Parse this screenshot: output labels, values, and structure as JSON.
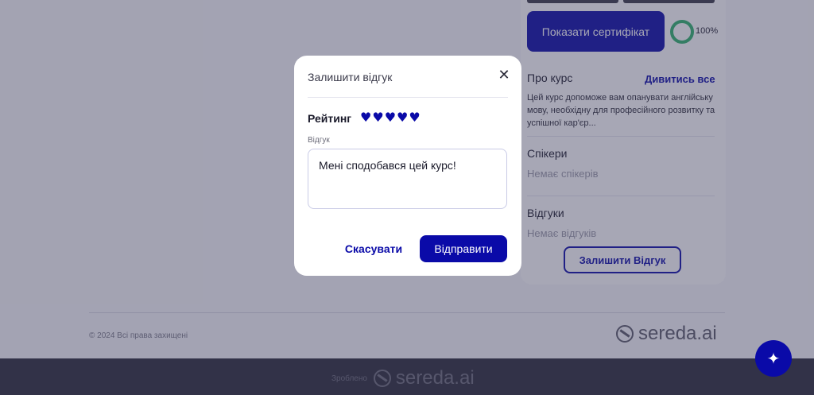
{
  "course_panel": {
    "certificate_button": "Показати сертифікат",
    "progress_percent": "100%",
    "progress_value": 100,
    "about_title": "Про курс",
    "see_all_link": "Дивитись все",
    "about_text": "Цей курс допоможе вам опанувати англійську мову, необхідну для професійного розвитку та успішної кар'єр...",
    "speakers_title": "Спікери",
    "speakers_empty": "Немає спікерів",
    "reviews_title": "Відгуки",
    "reviews_empty": "Немає відгуків",
    "leave_review_button": "Залишити Відгук"
  },
  "footer": {
    "copyright": "© 2024 Всі права захищені",
    "brand": "sereda.ai",
    "made_by_label": "Зроблено",
    "made_by_brand": "sereda.ai"
  },
  "modal": {
    "title": "Залишити відгук",
    "close_icon": "close-icon",
    "rating_label": "Рейтинг",
    "rating_value": 5,
    "rating_max": 5,
    "review_label": "Відгук",
    "review_text": "Мені сподобався цей курс!",
    "cancel_button": "Скасувати",
    "submit_button": "Відправити"
  },
  "colors": {
    "primary": "#0a0aa8",
    "progress": "#2fb36c",
    "footer_bar": "#2b2b3a"
  },
  "ai_assistant_icon": "sparkle-icon"
}
